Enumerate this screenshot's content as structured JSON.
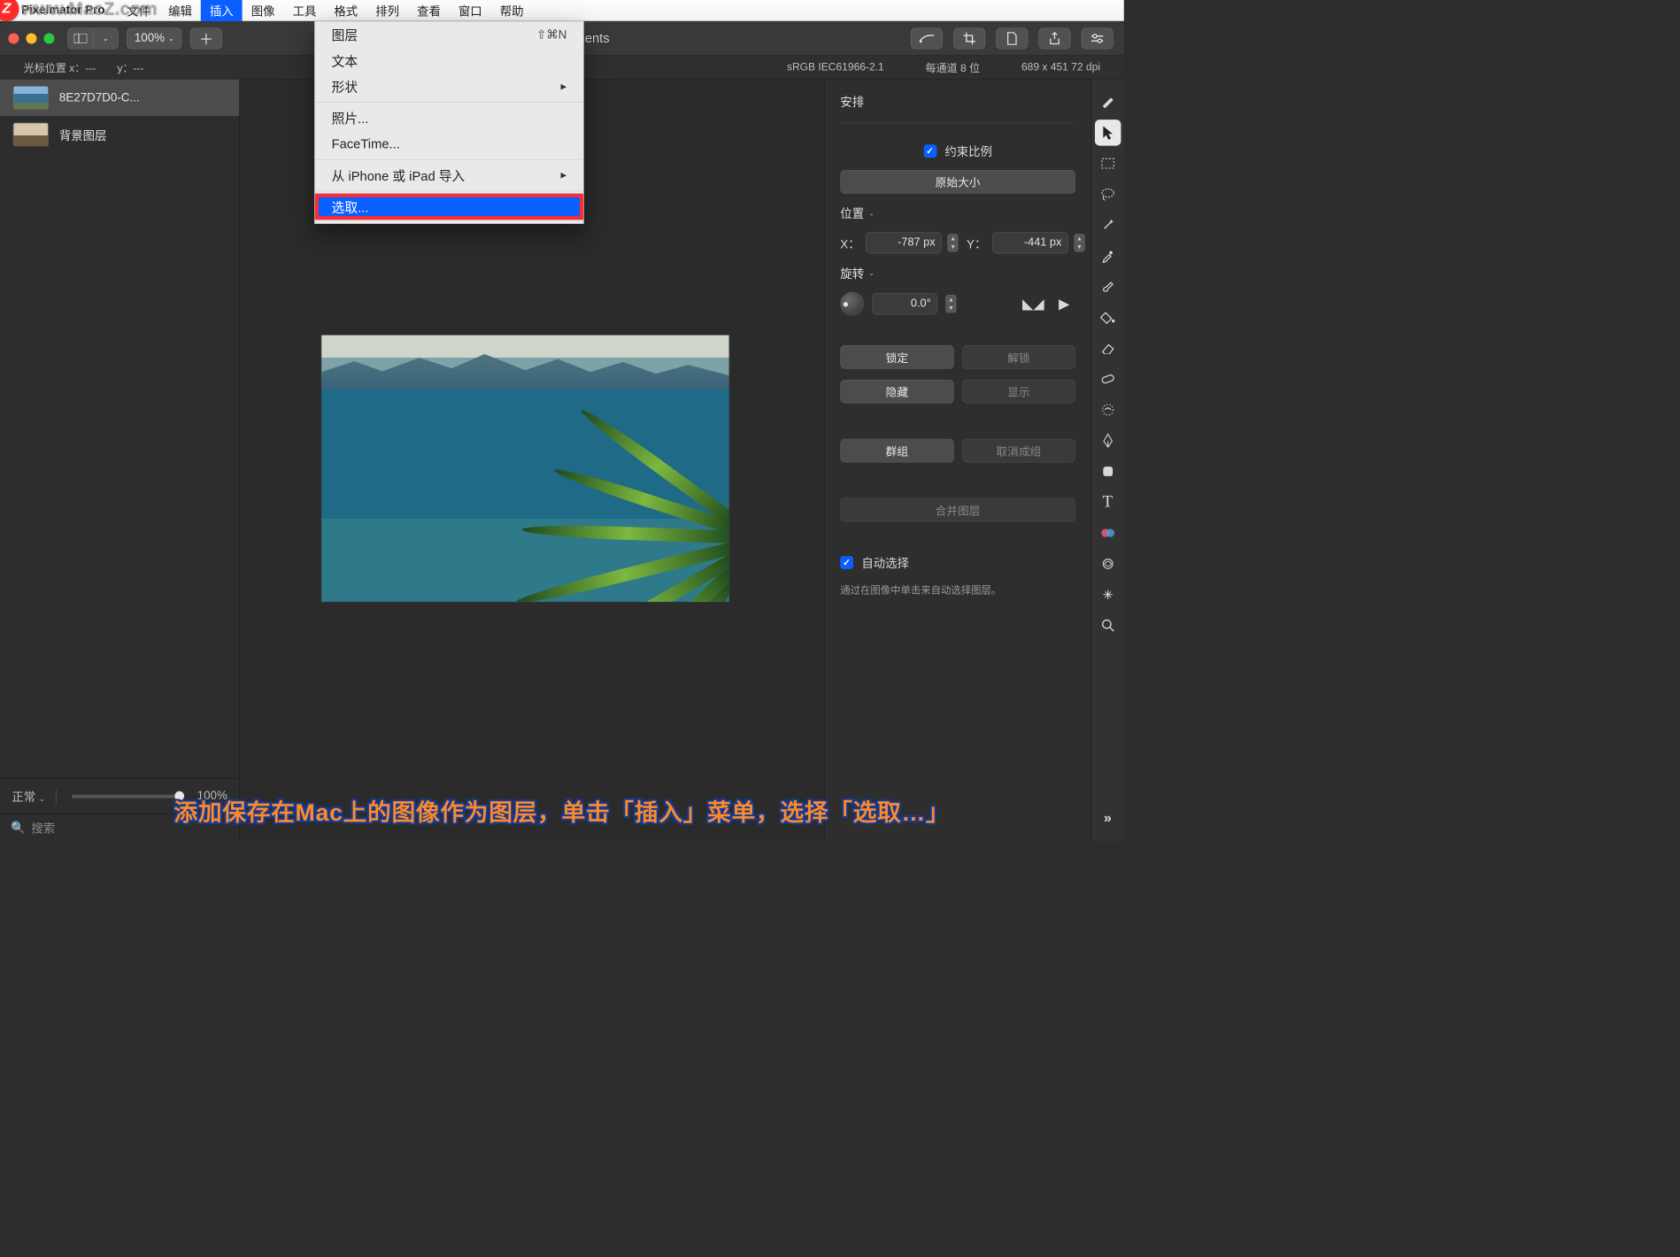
{
  "menubar": {
    "app_name": "Pixelmator Pro",
    "items": [
      "文件",
      "编辑",
      "插入",
      "图像",
      "工具",
      "格式",
      "排列",
      "查看",
      "窗口",
      "帮助"
    ],
    "active_index": 2
  },
  "watermark": {
    "badge": "Z",
    "text": "www.MacZ.com"
  },
  "toolbar": {
    "zoom": "100%",
    "doc_title_suffix": "rd-adjustments"
  },
  "status": {
    "cursor_label": "光标位置 x：---　　y：---",
    "color_profile": "sRGB IEC61966-2.1",
    "bit_depth": "每通道 8 位",
    "dimensions": "689 x 451 72 dpi"
  },
  "layers": {
    "items": [
      {
        "name": "8E27D7D0-C..."
      },
      {
        "name": "背景图层"
      }
    ],
    "blend_mode": "正常",
    "opacity_label": "100%",
    "search_placeholder": "搜索"
  },
  "inspector": {
    "arrange_title": "安排",
    "constrain_label": "约束比例",
    "original_size": "原始大小",
    "position_title": "位置",
    "x_label": "X：",
    "x_value": "-787 px",
    "y_label": "Y：",
    "y_value": "-441 px",
    "rotate_title": "旋转",
    "rotate_value": "0.0°",
    "lock": "锁定",
    "unlock": "解锁",
    "hide": "隐藏",
    "show": "显示",
    "group": "群组",
    "ungroup": "取消成组",
    "merge": "合并图层",
    "auto_select": "自动选择",
    "auto_select_hint": "通过在图像中单击来自动选择图层。"
  },
  "dropdown": {
    "items": [
      {
        "label": "图层",
        "shortcut": "⇧⌘N"
      },
      {
        "label": "文本"
      },
      {
        "label": "形状",
        "arrow": true
      },
      {
        "sep": true
      },
      {
        "label": "照片..."
      },
      {
        "label": "FaceTime..."
      },
      {
        "sep": true
      },
      {
        "label": "从 iPhone 或 iPad 导入",
        "arrow": true
      },
      {
        "sep": true
      },
      {
        "label": "选取...",
        "highlight": true
      }
    ]
  },
  "caption": "添加保存在Mac上的图像作为图层，单击「插入」菜单，选择「选取…」",
  "tools": [
    "styles",
    "arrow",
    "marquee",
    "lasso",
    "wand",
    "eyedrop",
    "brush",
    "bucket",
    "erase",
    "heal",
    "shape",
    "pen",
    "rect",
    "type",
    "color",
    "fx",
    "sparkle",
    "zoom",
    "more"
  ]
}
